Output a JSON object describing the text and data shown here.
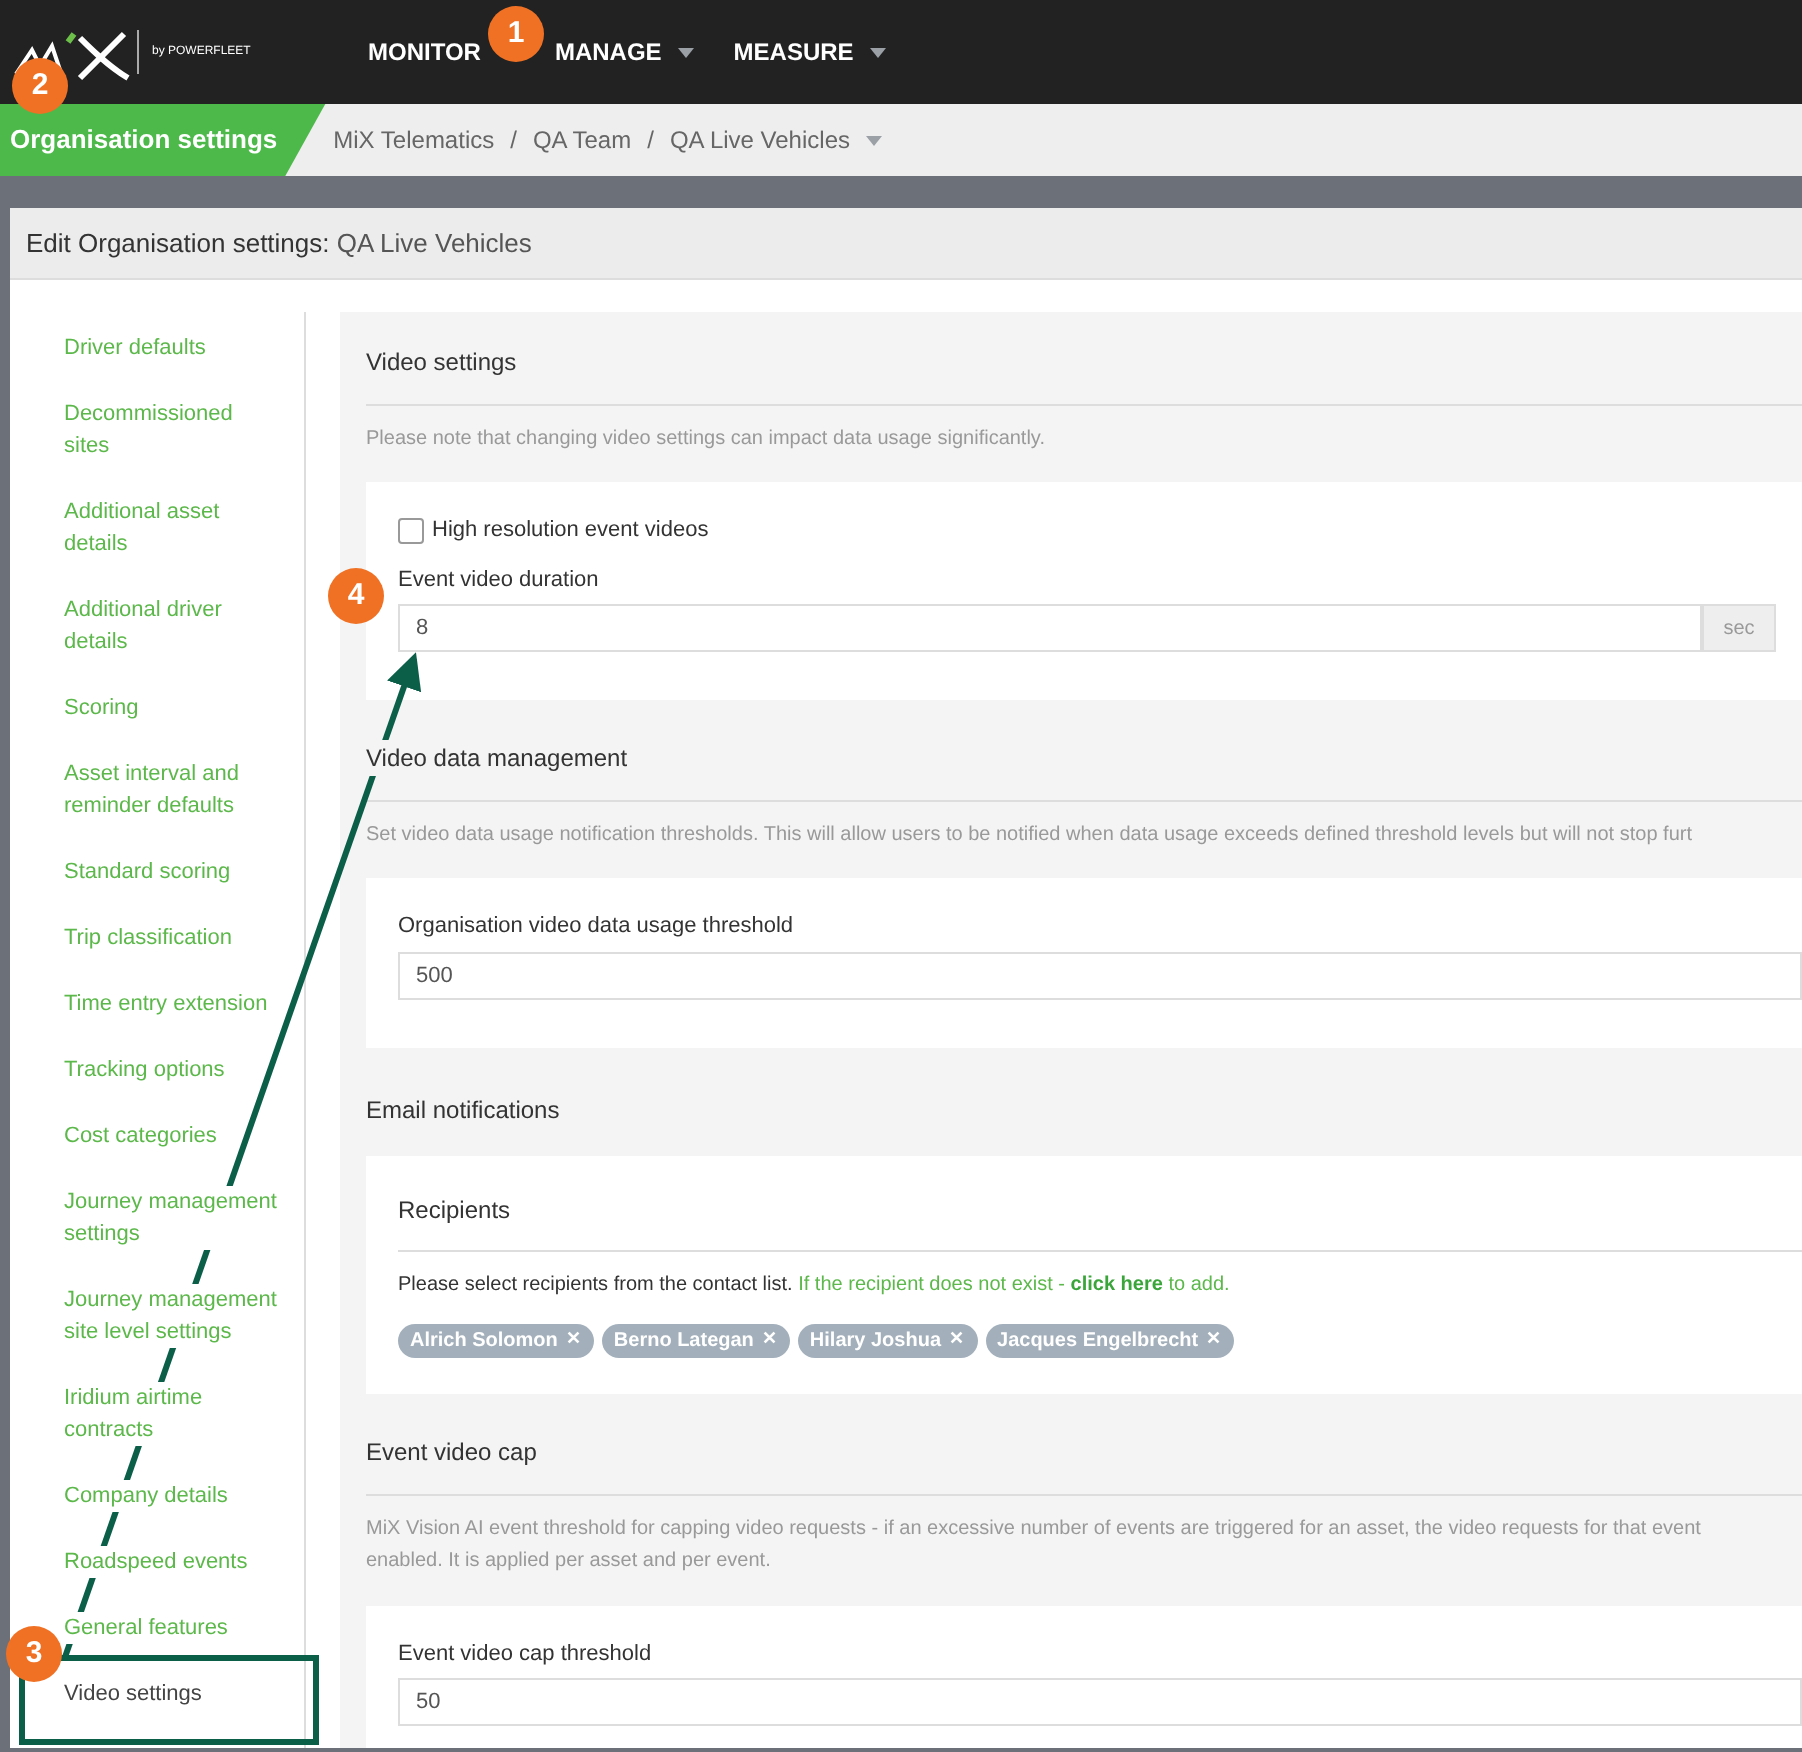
{
  "nav": {
    "logo": "by POWERFLEET",
    "items": [
      {
        "label": "MONITOR",
        "dropdown": false
      },
      {
        "label": "MANAGE",
        "dropdown": true
      },
      {
        "label": "MEASURE",
        "dropdown": true
      }
    ]
  },
  "breadcrumb": {
    "section": "Organisation settings",
    "separator": "/",
    "path": [
      "MiX Telematics",
      "QA Team",
      "QA Live Vehicles"
    ]
  },
  "panel": {
    "title_prefix": "Edit Organisation settings:",
    "title_value": "QA Live Vehicles"
  },
  "sidebar": {
    "items": [
      {
        "label": "Driver defaults",
        "selected": false
      },
      {
        "label": "Decommissioned sites",
        "selected": false
      },
      {
        "label": "Additional asset details",
        "selected": false
      },
      {
        "label": "Additional driver details",
        "selected": false
      },
      {
        "label": "Scoring",
        "selected": false
      },
      {
        "label": "Asset interval and reminder defaults",
        "selected": false
      },
      {
        "label": "Standard scoring",
        "selected": false
      },
      {
        "label": "Trip classification",
        "selected": false
      },
      {
        "label": "Time entry extension",
        "selected": false
      },
      {
        "label": "Tracking options",
        "selected": false
      },
      {
        "label": "Cost categories",
        "selected": false
      },
      {
        "label": "Journey management settings",
        "selected": false
      },
      {
        "label": "Journey management site level settings",
        "selected": false
      },
      {
        "label": "Iridium airtime contracts",
        "selected": false
      },
      {
        "label": "Company details",
        "selected": false
      },
      {
        "label": "Roadspeed events",
        "selected": false
      },
      {
        "label": "General features",
        "selected": false
      },
      {
        "label": "Video settings",
        "selected": true
      }
    ]
  },
  "video_settings": {
    "heading": "Video settings",
    "note": "Please note that changing video settings can impact data usage significantly.",
    "checkbox": {
      "label": "High resolution event videos",
      "checked": false
    },
    "duration": {
      "label": "Event video duration",
      "value": "8",
      "unit": "sec"
    }
  },
  "video_data_management": {
    "heading": "Video data management",
    "note": "Set video data usage notification thresholds. This will allow users to be notified when data usage exceeds defined threshold levels but will not stop furt",
    "threshold": {
      "label": "Organisation video data usage threshold",
      "value": "500"
    }
  },
  "email_notifications": {
    "heading": "Email notifications",
    "subheading": "Recipients",
    "instruction": "Please select recipients from the contact list.",
    "hint_before": "If the recipient does not exist -",
    "link": "click here",
    "hint_after": "to add.",
    "recipients": [
      {
        "name": "Alrich Solomon",
        "remove": "✕"
      },
      {
        "name": "Berno Lategan",
        "remove": "✕"
      },
      {
        "name": "Hilary Joshua",
        "remove": "✕"
      },
      {
        "name": "Jacques Engelbrecht",
        "remove": "✕"
      }
    ]
  },
  "event_video_cap": {
    "heading": "Event video cap",
    "note_lines": [
      "MiX Vision AI event threshold for capping video requests - if an excessive number of events are triggered for an asset, the video requests for that event",
      "enabled. It is applied per asset and per event."
    ],
    "threshold": {
      "label": "Event video cap threshold",
      "value": "50"
    }
  },
  "callouts": [
    {
      "number": "1"
    },
    {
      "number": "2"
    },
    {
      "number": "3"
    },
    {
      "number": "4"
    }
  ]
}
